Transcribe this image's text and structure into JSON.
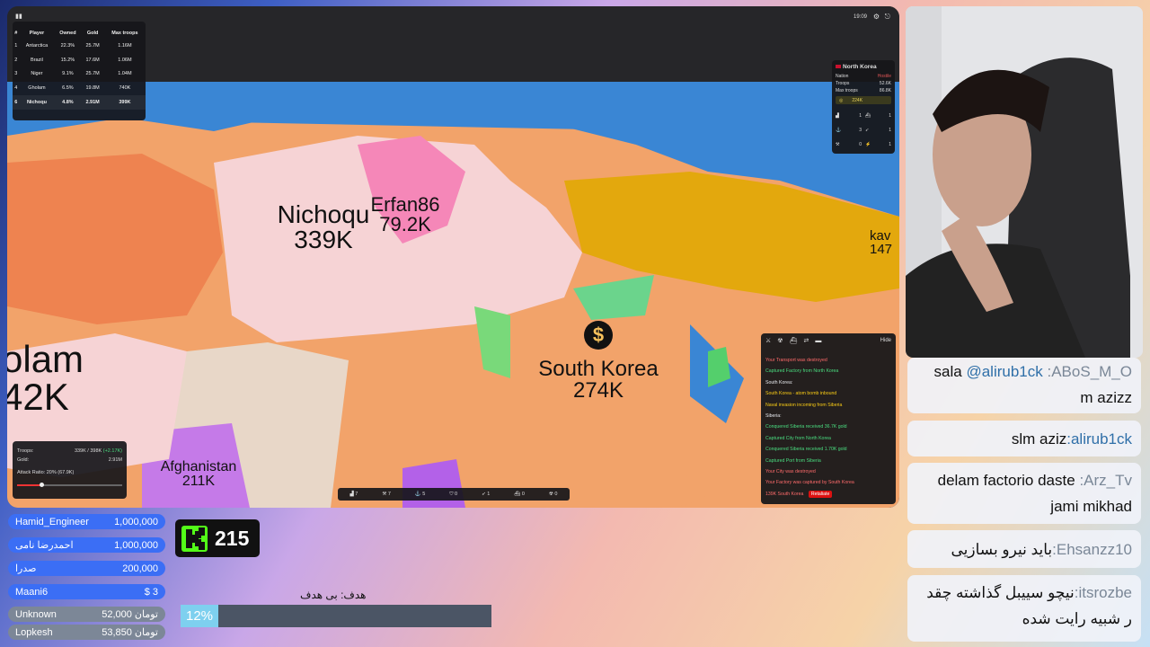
{
  "game": {
    "leaderboard": {
      "headers": [
        "#",
        "Player",
        "Owned",
        "Gold",
        "Max troops"
      ],
      "rows": [
        {
          "rank": "1",
          "player": "Antarctica",
          "owned": "22.3%",
          "gold": "25.7M",
          "troops": "1.16M"
        },
        {
          "rank": "2",
          "player": "Brazil",
          "owned": "15.2%",
          "gold": "17.6M",
          "troops": "1.06M"
        },
        {
          "rank": "3",
          "player": "Niger",
          "owned": "9.1%",
          "gold": "25.7M",
          "troops": "1.04M"
        },
        {
          "rank": "4",
          "player": "Gholam",
          "owned": "6.5%",
          "gold": "19.8M",
          "troops": "740K"
        },
        {
          "rank": "6",
          "player": "Nichoqu",
          "owned": "4.8%",
          "gold": "2.91M",
          "troops": "399K"
        }
      ]
    },
    "clock": "19:09",
    "nation_panel": {
      "name": "North Korea",
      "nation_label": "Nation",
      "nation_value": "Hostile",
      "troops_label": "Troops",
      "troops_value": "52.6K",
      "max_troops_label": "Max troops",
      "max_troops_value": "86.8K",
      "gold": "224K",
      "counts": [
        "1",
        "1",
        "3",
        "1",
        "0",
        "1"
      ]
    },
    "map_labels": {
      "nichoqu_name": "Nichoqu",
      "nichoqu_troops": "339K",
      "erfan_name": "Erfan86",
      "erfan_troops": "79.2K",
      "skorea_name": "South Korea",
      "skorea_troops": "274K",
      "gholam_name": "olam",
      "gholam_troops": "42K",
      "afghan_name": "Afghanistan",
      "afghan_troops": "211K",
      "kav_name": "kav",
      "kav_troops": "147"
    },
    "player_panel": {
      "troops_label": "Troops:",
      "troops_value": "339K / 398K",
      "troops_rate": "(+2.17K)",
      "gold_label": "Gold:",
      "gold_value": "2.91M",
      "ratio_label": "Attack Ratio: 20% (67.9K)"
    },
    "bottom_bar": [
      "7",
      "7",
      "5",
      "0",
      "1",
      "0",
      "0"
    ],
    "events": {
      "hide_label": "Hide",
      "items": [
        {
          "text": "Your Transport was destroyed",
          "color": "#ff6b6b"
        },
        {
          "text": "Captured Factory from North Korea",
          "color": "#4ade80"
        },
        {
          "text": "South Korea:",
          "color": "#e5e7eb"
        },
        {
          "text": "South Korea - atom bomb inbound",
          "color": "#facc15"
        },
        {
          "text": "Naval invasion incoming from Siberia",
          "color": "#facc15"
        },
        {
          "text": "Siberia:",
          "color": "#e5e7eb"
        },
        {
          "text": "Conquered Siberia received 36.7K gold",
          "color": "#4ade80"
        },
        {
          "text": "Captured City from North Korea",
          "color": "#4ade80"
        },
        {
          "text": "Conquered Siberia received 1.70K gold",
          "color": "#4ade80"
        },
        {
          "text": "Captured Port from Siberia",
          "color": "#4ade80"
        },
        {
          "text": "Your City was destroyed",
          "color": "#ff6b6b"
        },
        {
          "text": "Your Factory was captured by South Korea",
          "color": "#ff6b6b"
        },
        {
          "text": "139K South Korea",
          "color": "#ff6b6b"
        }
      ],
      "retaliate_label": "Retaliate"
    }
  },
  "chat": [
    {
      "user": ":ABoS_M_O",
      "mention": "@alirub1ck",
      "message_start": "sala",
      "message_end": "m azizz"
    },
    {
      "user": ":alirub1ck",
      "message": "slm aziz"
    },
    {
      "user": ":Arz_Tv",
      "message_start": "delam factorio daste",
      "message_end": "jami mikhad"
    },
    {
      "user": ":Ehsanzz10",
      "message": "باید نیرو بسازیی"
    },
    {
      "user": ":itsrozbe",
      "message_start": "نیچو سییبل گذاشته چقد",
      "message_end": "ر شبیه رایت شده"
    }
  ],
  "donations": [
    {
      "name": "Hamid_Engineer",
      "amount": "1,000,000",
      "color": "#3b6ef5"
    },
    {
      "name": "احمدرضا نامی",
      "amount": "1,000,000",
      "color": "#3b6ef5"
    },
    {
      "name": "صدرا",
      "amount": "200,000",
      "color": "#3b6ef5"
    },
    {
      "name": "Maani6",
      "amount": "$ 3",
      "color": "#3b6ef5"
    },
    {
      "name": "Unknown",
      "amount": "52,000 تومان",
      "color": "#7c8797"
    },
    {
      "name": "Lopkesh",
      "amount": "53,850 تومان",
      "color": "#7c8797"
    }
  ],
  "kick": {
    "count": "215"
  },
  "goal": {
    "label": "هدف: بی هدف",
    "percent": "12%",
    "fraction": 0.12
  }
}
